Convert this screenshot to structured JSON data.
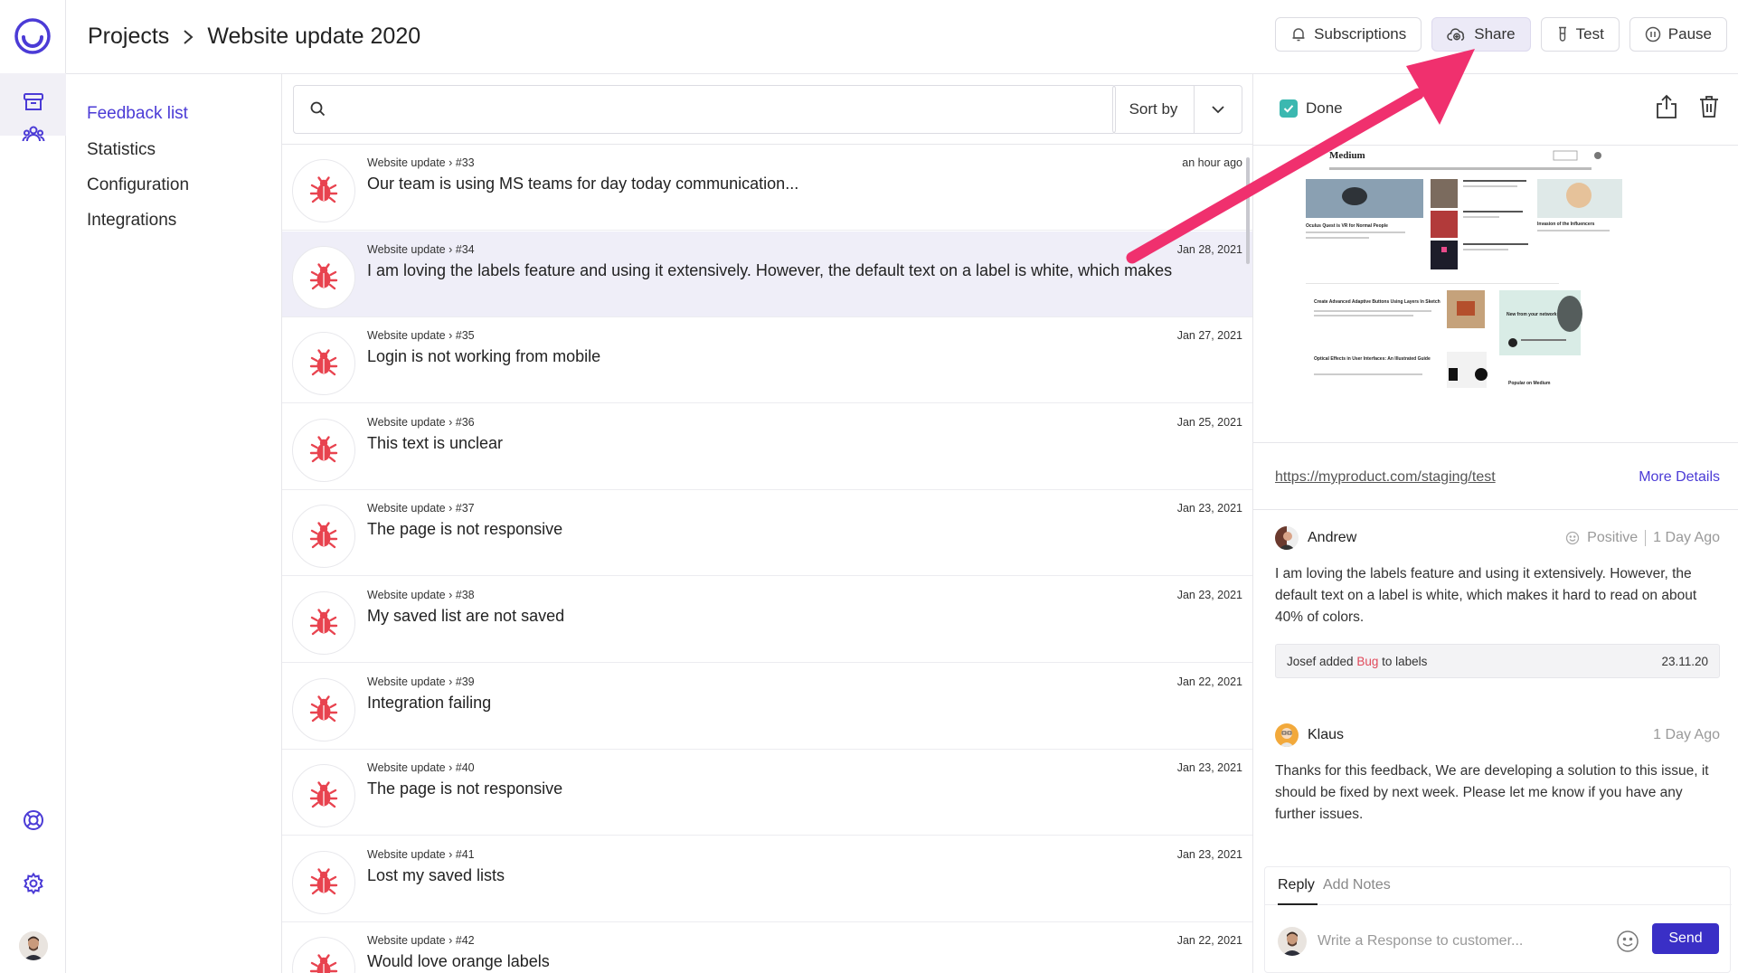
{
  "app": {
    "logo": "app-logo"
  },
  "header": {
    "breadcrumb_root": "Projects",
    "breadcrumb_current": "Website update 2020",
    "actions": {
      "subscriptions": "Subscriptions",
      "share": "Share",
      "test": "Test",
      "pause": "Pause"
    }
  },
  "subnav": {
    "items": [
      "Feedback list",
      "Statistics",
      "Configuration",
      "Integrations"
    ]
  },
  "list": {
    "search_placeholder": "",
    "sort_label": "Sort by",
    "items": [
      {
        "project": "Website update › #33",
        "title": "Our team is using MS teams for day today communication...",
        "date": "an hour ago"
      },
      {
        "project": "Website update › #34",
        "title": "I am loving the labels feature and using it extensively.  However, the default text on a label is white, which makes",
        "date": "Jan 28, 2021"
      },
      {
        "project": "Website update › #35",
        "title": "Login is not working from mobile",
        "date": "Jan 27, 2021"
      },
      {
        "project": "Website update › #36",
        "title": "This text is unclear",
        "date": "Jan 25, 2021"
      },
      {
        "project": "Website update › #37",
        "title": "The page is not responsive",
        "date": "Jan 23, 2021"
      },
      {
        "project": "Website update › #38",
        "title": "My saved list are not saved",
        "date": "Jan 23, 2021"
      },
      {
        "project": "Website update › #39",
        "title": "Integration failing",
        "date": "Jan 22, 2021"
      },
      {
        "project": "Website update › #40",
        "title": "The page is not responsive",
        "date": "Jan 23, 2021"
      },
      {
        "project": "Website update › #41",
        "title": "Lost my saved lists",
        "date": "Jan 23, 2021"
      },
      {
        "project": "Website update › #42",
        "title": "Would love orange labels",
        "date": "Jan 22, 2021"
      }
    ]
  },
  "detail": {
    "done_label": "Done",
    "screenshot": {
      "site_name": "Medium",
      "headlines": [
        "Oculus Quest is VR for Normal People",
        "Create Advanced Adaptive Buttons Using Layers In Sketch",
        "Optical Effects in User Interfaces: An Illustrated Guide",
        "New from your network",
        "Popular on Medium",
        "Invasion of the Influencers"
      ]
    },
    "url": "https://myproduct.com/staging/test",
    "more_details": "More Details",
    "comments": [
      {
        "author": "Andrew",
        "sentiment": "Positive",
        "time": "1 Day Ago",
        "body": "I am loving the labels feature and using it extensively. However, the default text on a label is white, which makes it hard to read on about 40% of colors."
      },
      {
        "author": "Klaus",
        "time": "1 Day Ago",
        "body": "Thanks for this feedback, We are developing a solution to this issue, it should be fixed by next week. Please let me know if you have any further issues."
      }
    ],
    "activity": {
      "prefix": "Josef added",
      "tag": "Bug",
      "suffix": "to labels",
      "date": "23.11.20"
    },
    "reply": {
      "tab_reply": "Reply",
      "tab_notes": "Add Notes",
      "placeholder": "Write a Response to customer...",
      "send": "Send"
    }
  },
  "colors": {
    "accent": "#4b3bd6",
    "send_button": "#3a2fc6",
    "bug_icon": "#e8434f",
    "done_check": "#3bb8b0",
    "arrow": "#f0306e",
    "selected_row": "#efeef8"
  }
}
